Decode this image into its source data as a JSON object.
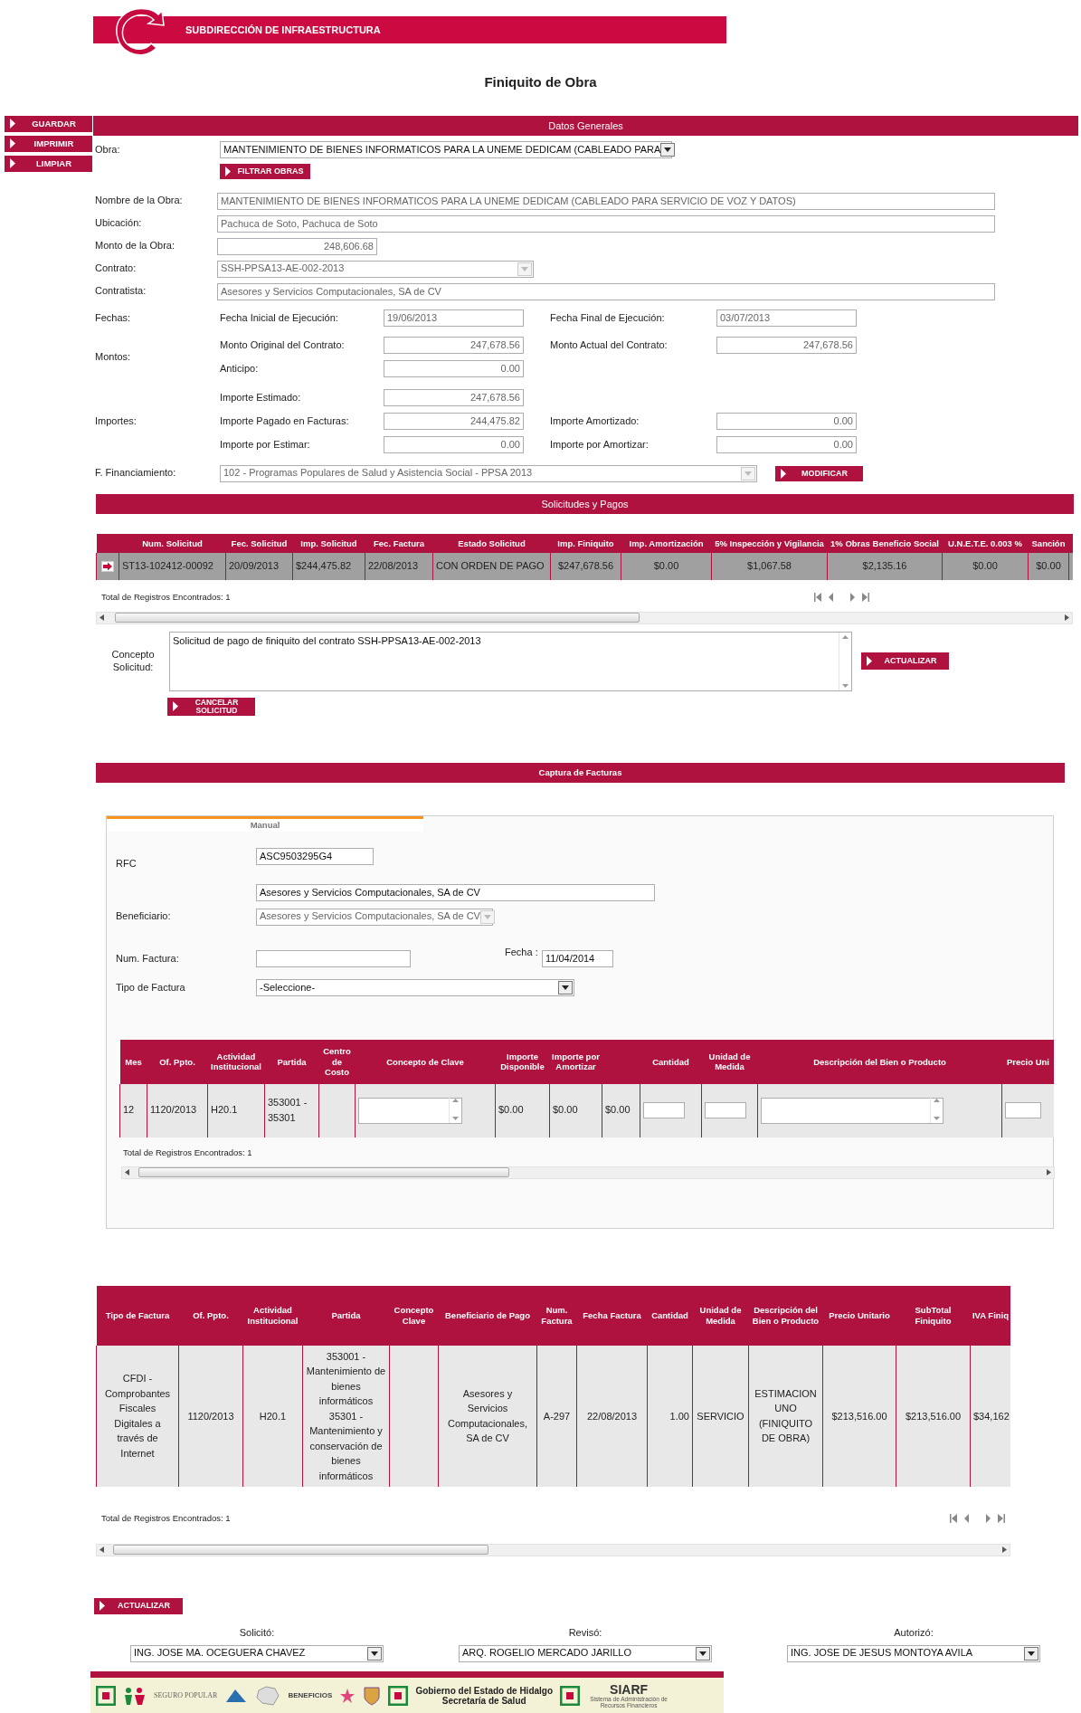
{
  "header": {
    "title": "SUBDIRECCIÓN DE INFRAESTRUCTURA"
  },
  "page_title": "Finiquito de Obra",
  "side_buttons": [
    "GUARDAR",
    "IMPRIMIR",
    "LIMPIAR"
  ],
  "general": {
    "heading": "Datos Generales",
    "obra": {
      "label": "Obra:",
      "value": "MANTENIMIENTO DE BIENES INFORMATICOS PARA LA UNEME DEDICAM (CABLEADO PARA",
      "disabled": false
    },
    "filter_button": "FILTRAR OBRAS",
    "fields": [
      {
        "label": "Nombre de la Obra:",
        "value": "MANTENIMIENTO DE BIENES INFORMATICOS PARA LA UNEME DEDICAM (CABLEADO PARA SERVICIO DE VOZ Y DATOS)",
        "kind": "wide"
      },
      {
        "label": "Ubicación:",
        "value": "Pachuca de Soto, Pachuca de Soto",
        "kind": "wide"
      },
      {
        "label": "Monto de la Obra:",
        "value": "248,606.68",
        "kind": "amount"
      },
      {
        "label": "Contrato:",
        "value": "SSH-PPSA13-AE-002-2013",
        "kind": "select",
        "disabled": true
      },
      {
        "label": "Contratista:",
        "value": "Asesores y Servicios Computacionales, SA de CV",
        "kind": "wide"
      }
    ],
    "groups": [
      {
        "label": "Fechas:",
        "lines": [
          [
            {
              "label": "Fecha Inicial de Ejecución:",
              "value": "19/06/2013",
              "kind": "date"
            },
            {
              "label": "Fecha Final de Ejecución:",
              "value": "03/07/2013",
              "kind": "date"
            }
          ]
        ]
      },
      {
        "label": "Montos:",
        "lines": [
          [
            {
              "label": "Monto Original del Contrato:",
              "value": "247,678.56",
              "kind": "amount"
            },
            {
              "label": "Monto Actual del Contrato:",
              "value": "247,678.56",
              "kind": "amount"
            }
          ],
          [
            {
              "label": "Anticipo:",
              "value": "0.00",
              "kind": "amount"
            }
          ]
        ]
      },
      {
        "label": "Importes:",
        "lines": [
          [
            {
              "label": "Importe Estimado:",
              "value": "247,678.56",
              "kind": "amount"
            }
          ],
          [
            {
              "label": "Importe Pagado en Facturas:",
              "value": "244,475.82",
              "kind": "amount"
            },
            {
              "label": "Importe Amortizado:",
              "value": "0.00",
              "kind": "amount"
            }
          ],
          [
            {
              "label": "Importe por Estimar:",
              "value": "0.00",
              "kind": "amount"
            },
            {
              "label": "Importe por Amortizar:",
              "value": "0.00",
              "kind": "amount"
            }
          ]
        ]
      }
    ],
    "financing": {
      "label": "F. Financiamiento:",
      "value": "102 - Programas Populares de Salud y Asistencia Social - PPSA 2013",
      "disabled": true
    },
    "modify_button": "MODIFICAR"
  },
  "requests": {
    "heading": "Solicitudes y Pagos",
    "columns": [
      "Num. Solicitud",
      "Fec. Solicitud",
      "Imp. Solicitud",
      "Fec. Factura",
      "Estado Solicitud",
      "Imp. Finiquito",
      "Imp. Amortización",
      "5% Inspección y Vigilancia",
      "1% Obras Beneficio Social",
      "U.N.E.T.E. 0.003 %",
      "Sanción"
    ],
    "rows": [
      {
        "selected": true,
        "cells": [
          "ST13-102412-00092",
          "20/09/2013",
          "$244,475.82",
          "22/08/2013",
          "CON ORDEN DE PAGO",
          "$247,678.56",
          "$0.00",
          "$1,067.58",
          "$2,135.16",
          "$0.00",
          "$0.00"
        ]
      }
    ],
    "total": "Total de Registros Encontrados: 1",
    "concept": {
      "label": "Concepto Solicitud:",
      "value": "Solicitud de pago de finiquito del contrato SSH-PPSA13-AE-002-2013"
    },
    "update_button": "ACTUALIZAR",
    "cancel_button": "CANCELAR SOLICITUD"
  },
  "capture": {
    "heading": "Captura de Facturas",
    "tabs": [
      {
        "label": "Manual",
        "selected": true
      }
    ],
    "rfc": {
      "label": "RFC",
      "value": "ASC9503295G4"
    },
    "beneficiary_name": "Asesores y Servicios Computacionales, SA de CV",
    "beneficiary": {
      "label": "Beneficiario:",
      "value": "Asesores y Servicios Computacionales, SA de CV",
      "disabled": true
    },
    "invoice_number": {
      "label": "Num. Factura:"
    },
    "date": {
      "label": "Fecha :",
      "value": "11/04/2014"
    },
    "invoice_type": {
      "label": "Tipo de Factura",
      "value": "-Seleccione-",
      "disabled": false
    },
    "table": {
      "columns": [
        {
          "label": "Mes"
        },
        {
          "label": "Of. Ppto."
        },
        {
          "label": "Actividad Institucional"
        },
        {
          "label": "Partida"
        },
        {
          "label": "Centro de Costo"
        },
        {
          "label": "Concepto de Clave"
        },
        {
          "label": "Importe Disponible"
        },
        {
          "label": "Importe por Amortizar"
        },
        {},
        {
          "label": "Cantidad"
        },
        {
          "label": "Unidad de Medida"
        },
        {
          "label": "Descripción del Bien o Producto"
        },
        {
          "label": "Precio Uni"
        }
      ],
      "rows": [
        {
          "cells": [
            {
              "kind": "text",
              "text": "12"
            },
            {
              "kind": "text",
              "text": "1120/2013"
            },
            {
              "kind": "text",
              "text": "H20.1"
            },
            {
              "kind": "text",
              "text": "353001 - 35301"
            },
            {
              "kind": "blank"
            },
            {
              "kind": "textarea"
            },
            {
              "kind": "text",
              "text": "$0.00"
            },
            {
              "kind": "text",
              "text": "$0.00"
            },
            {
              "kind": "text",
              "text": "$0.00"
            },
            {
              "kind": "input"
            },
            {
              "kind": "input"
            },
            {
              "kind": "textarea"
            },
            {
              "kind": "input"
            }
          ]
        }
      ]
    },
    "total": "Total de Registros Encontrados: 1"
  },
  "invoices": {
    "columns": [
      "Tipo de Factura",
      "Of. Ppto.",
      "Actividad Institucional",
      "Partida",
      "Concepto Clave",
      "Beneficiario de Pago",
      "Num. Factura",
      "Fecha Factura",
      "Cantidad",
      "Unidad de Medida",
      "Descripción del Bien o Producto",
      "Precio Unitario",
      "SubTotal Finiquito",
      "IVA Finiq"
    ],
    "rows": [
      {
        "cells": [
          "CFDI - Comprobantes Fiscales Digitales a través de Internet",
          "1120/2013",
          "H20.1",
          "353001 - Mantenimiento de bienes informáticos 35301 - Mantenimiento y conservación de bienes informáticos",
          "",
          "Asesores y Servicios Computacionales, SA de CV",
          "A-297",
          "22/08/2013",
          "1.00",
          "SERVICIO",
          "ESTIMACION UNO (FINIQUITO DE OBRA)",
          "$213,516.00",
          "$213,516.00",
          "$34,162"
        ]
      }
    ],
    "total": "Total de Registros Encontrados: 1"
  },
  "approval": {
    "update_button": "ACTUALIZAR",
    "signers": [
      {
        "label": "Solicitó:",
        "value": "ING. JOSE MA. OCEGUERA CHAVEZ",
        "disabled": false
      },
      {
        "label": "Revisó:",
        "value": "ARQ. ROGELIO MERCADO JARILLO",
        "disabled": false
      },
      {
        "label": "Autorizó:",
        "value": "ING. JOSE DE JESUS MONTOYA AVILA",
        "disabled": false
      }
    ]
  },
  "footer": {
    "program": "SEGURO POPULAR",
    "benefits": "BENEFICIOS",
    "government": "Gobierno del Estado de Hidalgo",
    "department": "Secretaría de Salud",
    "system": "SIARF",
    "system_caption": "Sistema de Administración de Recursos Financieros"
  }
}
